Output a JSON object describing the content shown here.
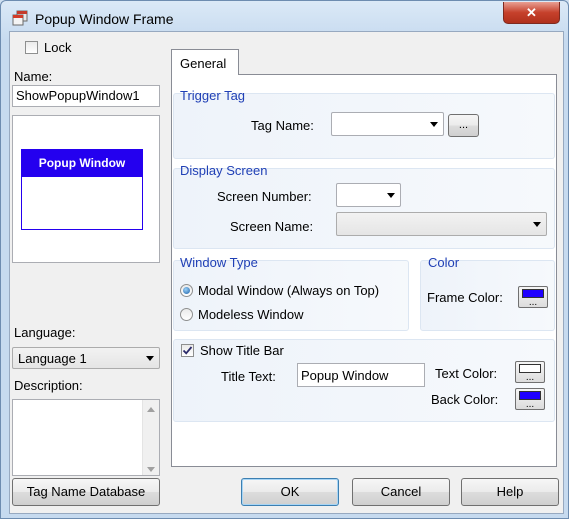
{
  "window": {
    "title": "Popup Window Frame",
    "close_glyph": "✕"
  },
  "left": {
    "lock_label": "Lock",
    "name_label": "Name:",
    "name_value": "ShowPopupWindow1",
    "preview_title": "Popup Window",
    "language_label": "Language:",
    "language_value": "Language 1",
    "description_label": "Description:",
    "description_value": ""
  },
  "tab": {
    "label": "General"
  },
  "trigger_tag": {
    "title": "Trigger Tag",
    "tag_name_label": "Tag Name:",
    "tag_name_value": "",
    "browse_label": "..."
  },
  "display_screen": {
    "title": "Display Screen",
    "screen_number_label": "Screen Number:",
    "screen_number_value": "",
    "screen_name_label": "Screen Name:",
    "screen_name_value": ""
  },
  "window_type": {
    "title": "Window Type",
    "modal_label": "Modal Window (Always on Top)",
    "modeless_label": "Modeless Window",
    "selected": "modal"
  },
  "color": {
    "title": "Color",
    "frame_color_label": "Frame Color:",
    "frame_color": "#1f00ff"
  },
  "title_bar": {
    "show_label": "Show Title Bar",
    "show_checked": true,
    "title_text_label": "Title Text:",
    "title_text_value": "Popup Window",
    "text_color_label": "Text Color:",
    "text_color": "#ffffff",
    "back_color_label": "Back Color:",
    "back_color": "#1f00ff",
    "swatch_dots": "..."
  },
  "footer": {
    "tag_db_label": "Tag Name Database",
    "ok_label": "OK",
    "cancel_label": "Cancel",
    "help_label": "Help"
  },
  "colors": {
    "accent_blue": "#1f3fb5",
    "preview_blue": "#2400ef"
  }
}
